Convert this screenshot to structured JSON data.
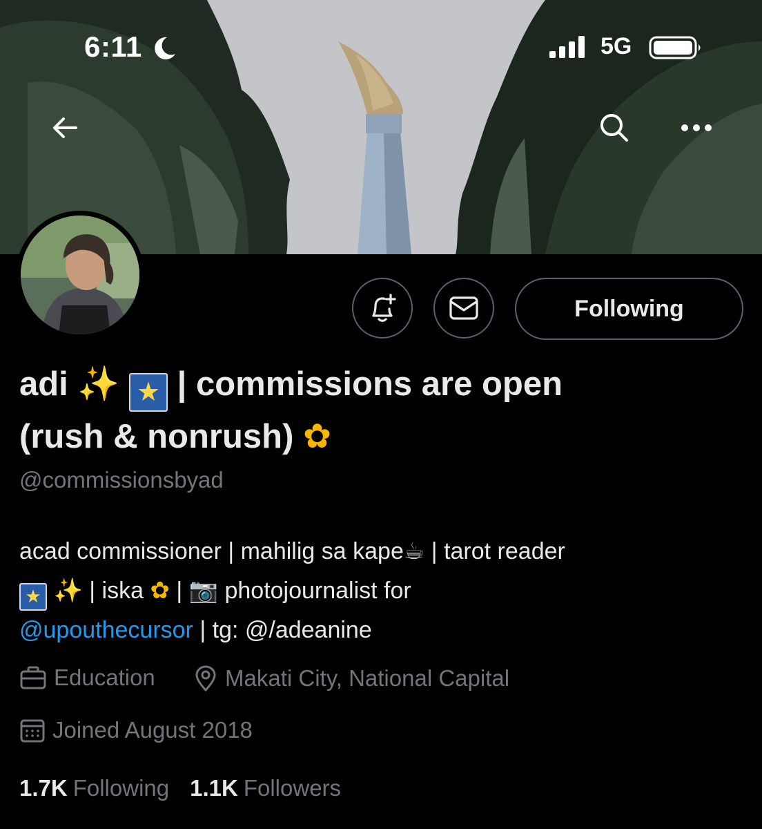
{
  "status_bar": {
    "time": "6:11",
    "network": "5G"
  },
  "nav": {
    "back_icon": "arrow-left-icon",
    "search_icon": "search-icon",
    "more_icon": "more-horizontal-icon"
  },
  "actions": {
    "notify_icon": "bell-plus-icon",
    "message_icon": "envelope-icon",
    "follow_label": "Following"
  },
  "profile": {
    "name_part1": "adi ",
    "name_sparkle": "✨",
    "name_star": "★",
    "name_part2": " | commissions are open",
    "name_part3": "(rush & nonrush)",
    "name_sunflower": "✿",
    "handle": "@commissionsbyad",
    "bio": {
      "line1_text": "acad commissioner | mahilig sa kape",
      "line1_coffee": "☕",
      "line1_end": " | tarot reader",
      "line2_star": "★",
      "line2_sparkle": "✨",
      "line2_text1": " | iska",
      "line2_sunflower": "✿",
      "line2_text2": " | ",
      "line2_camera": "📷",
      "line2_text3": " photojournalist for",
      "mention": "@upouthecursor",
      "line3_end": " | tg: @/adeanine"
    },
    "category": "Education",
    "location": "Makati City, National Capital",
    "joined": "Joined August 2018"
  },
  "stats": {
    "following_count": "1.7K",
    "following_label": "Following",
    "followers_count": "1.1K",
    "followers_label": "Followers"
  },
  "colors": {
    "background": "#000000",
    "text": "#e7e9ea",
    "secondary": "#71767b",
    "link": "#1d9bf0",
    "border": "#536471"
  }
}
